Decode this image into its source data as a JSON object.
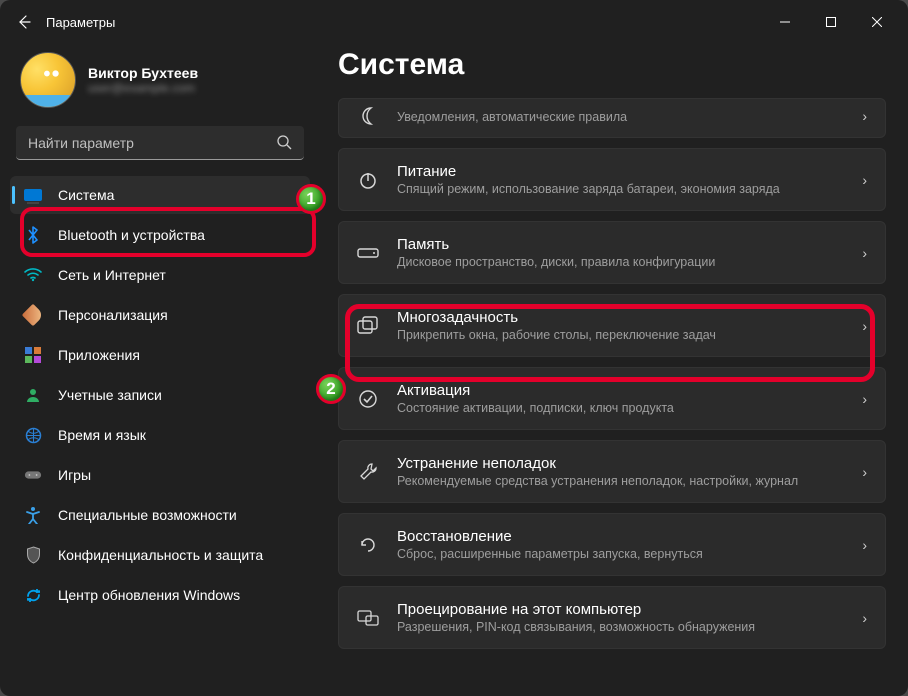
{
  "window": {
    "title": "Параметры"
  },
  "profile": {
    "name": "Виктор Бухтеев",
    "email": "user@example.com"
  },
  "search": {
    "placeholder": "Найти параметр"
  },
  "sidebar": {
    "items": [
      {
        "label": "Система"
      },
      {
        "label": "Bluetooth и устройства"
      },
      {
        "label": "Сеть и Интернет"
      },
      {
        "label": "Персонализация"
      },
      {
        "label": "Приложения"
      },
      {
        "label": "Учетные записи"
      },
      {
        "label": "Время и язык"
      },
      {
        "label": "Игры"
      },
      {
        "label": "Специальные возможности"
      },
      {
        "label": "Конфиденциальность и защита"
      },
      {
        "label": "Центр обновления Windows"
      }
    ]
  },
  "main": {
    "heading": "Система",
    "cards": [
      {
        "title": "",
        "sub": "Уведомления, автоматические правила"
      },
      {
        "title": "Питание",
        "sub": "Спящий режим, использование заряда батареи, экономия заряда"
      },
      {
        "title": "Память",
        "sub": "Дисковое пространство, диски, правила конфигурации"
      },
      {
        "title": "Многозадачность",
        "sub": "Прикрепить окна, рабочие столы, переключение задач"
      },
      {
        "title": "Активация",
        "sub": "Состояние активации, подписки, ключ продукта"
      },
      {
        "title": "Устранение неполадок",
        "sub": "Рекомендуемые средства устранения неполадок, настройки, журнал"
      },
      {
        "title": "Восстановление",
        "sub": "Сброс, расширенные параметры запуска, вернуться"
      },
      {
        "title": "Проецирование на этот компьютер",
        "sub": "Разрешения, PIN-код связывания, возможность обнаружения"
      }
    ]
  },
  "annotations": {
    "badge1": "1",
    "badge2": "2"
  }
}
